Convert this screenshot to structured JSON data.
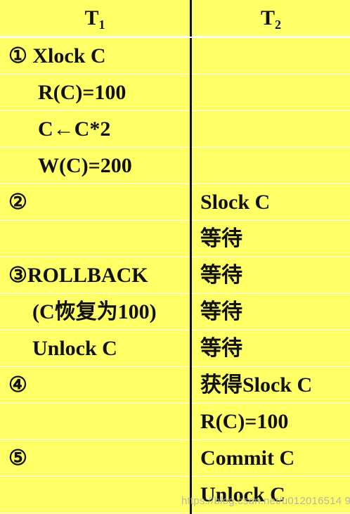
{
  "colors": {
    "cell_bg": "#ffff66",
    "divider": "#111111",
    "text": "#111111"
  },
  "header": {
    "t1_base": "T",
    "t1_sub": "1",
    "t2_base": "T",
    "t2_sub": "2"
  },
  "rows": [
    {
      "t1": "① Xlock C",
      "t2": ""
    },
    {
      "t1": "R(C)=100",
      "t2": ""
    },
    {
      "t1": "C←C*2",
      "t2": ""
    },
    {
      "t1": "W(C)=200",
      "t2": ""
    },
    {
      "t1": "②",
      "t2": "Slock C"
    },
    {
      "t1": "",
      "t2": "等待"
    },
    {
      "t1": "③ROLLBACK",
      "t2": "等待"
    },
    {
      "t1": "(C恢复为100)",
      "t2": "等待"
    },
    {
      "t1": "Unlock C",
      "t2": "等待"
    },
    {
      "t1": "④",
      "t2": "获得Slock C"
    },
    {
      "t1": "",
      "t2": "R(C)=100"
    },
    {
      "t1": "⑤",
      "t2": "Commit C"
    },
    {
      "t1": "",
      "t2": "Unlock C"
    }
  ],
  "watermark": "https://blog.csdn.net/u012016514 9"
}
